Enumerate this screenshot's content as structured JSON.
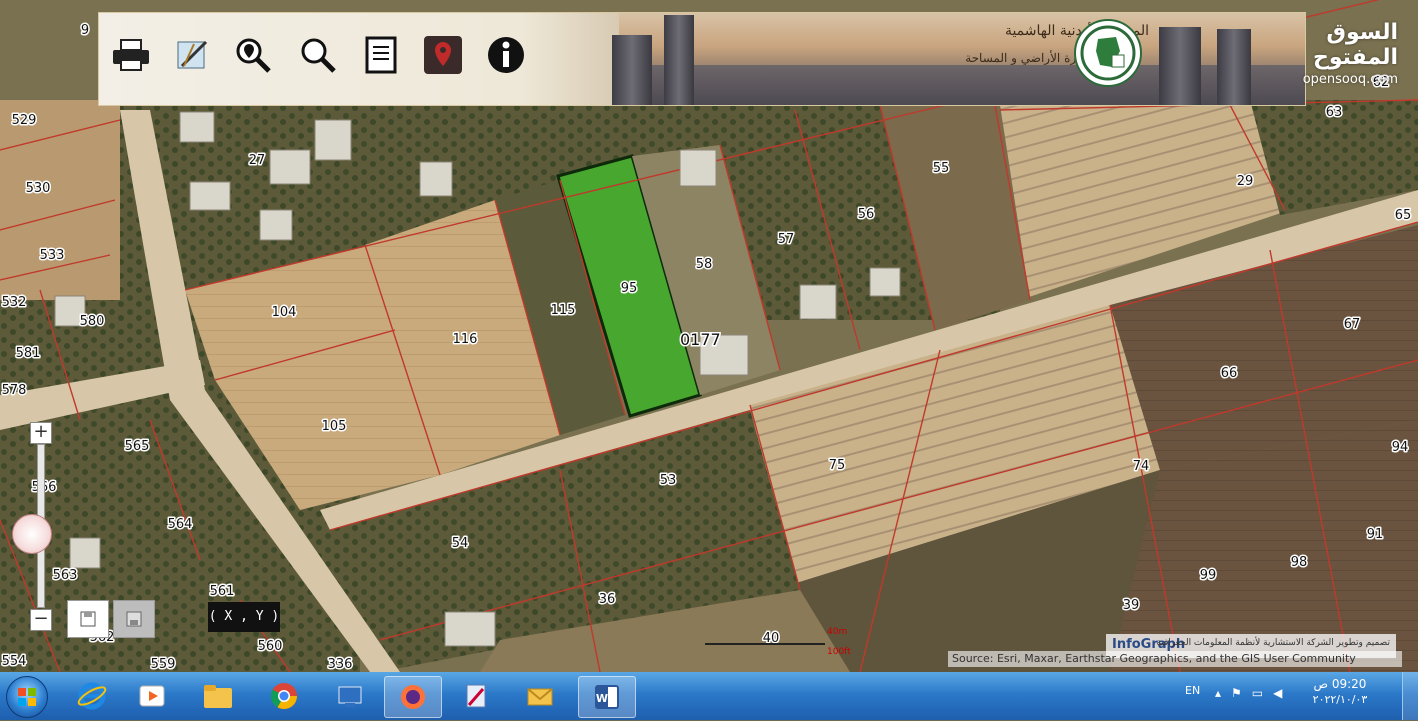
{
  "header": {
    "title": "المملكة الأردنية الهاشمية",
    "subtitle": "دائرة الأراضي و المساحة",
    "tools": [
      {
        "name": "print-icon"
      },
      {
        "name": "measure-icon"
      },
      {
        "name": "locate-search-icon"
      },
      {
        "name": "zoom-search-icon"
      },
      {
        "name": "report-icon"
      },
      {
        "name": "map-pin-icon"
      },
      {
        "name": "info-icon"
      }
    ]
  },
  "watermark": {
    "arabic": "السوق المفتوح",
    "latin": "opensooq.com"
  },
  "parcels": [
    "9",
    "529",
    "530",
    "533",
    "532",
    "581",
    "578",
    "580",
    "27",
    "104",
    "116",
    "105",
    "115",
    "95",
    "58",
    "57",
    "56",
    "55",
    "29",
    "63",
    "62",
    "65",
    "67",
    "66",
    "0177",
    "53",
    "54",
    "75",
    "74",
    "94",
    "91",
    "98",
    "99",
    "39",
    "36",
    "40",
    "565",
    "566",
    "564",
    "563",
    "561",
    "562",
    "560",
    "559",
    "554",
    "336"
  ],
  "highlighted_parcel": "95",
  "owner_label": "0177",
  "zoom": {
    "in": "+",
    "out": "−"
  },
  "coordinates_label": "( X , Y )",
  "scale": {
    "top": "40m",
    "bottom": "100ft"
  },
  "infograph": {
    "logo": "InfoGraph",
    "arabic": "تصميم وتطوير الشركة الاستشارية لأنظمة المعلومات الجغرافية"
  },
  "attribution": "Source: Esri, Maxar, Earthstar Geographics, and the GIS User Community",
  "taskbar": {
    "apps": [
      "internet-explorer",
      "media-player",
      "file-explorer",
      "chrome",
      "remote-desktop",
      "firefox",
      "whiteboard",
      "outlook",
      "word"
    ],
    "language": "EN",
    "time": "09:20 ص",
    "date": "٢٠٢٢/١٠/٠٣"
  },
  "colors": {
    "parcel_line": "#c0392b",
    "highlight": "#3fa32b",
    "banner_border": "#d9c9a3"
  }
}
